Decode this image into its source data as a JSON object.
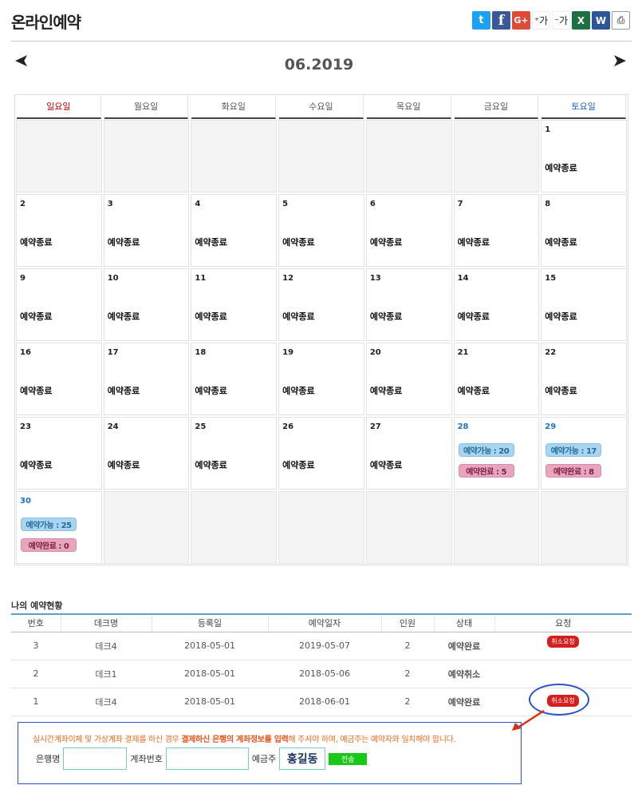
{
  "page": {
    "title": "온라인예약"
  },
  "share": {
    "twitter": "t",
    "facebook": "f",
    "google": "G+",
    "font_up": "⁺가",
    "font_down": "⁻가",
    "excel": "X",
    "word": "W",
    "print": "⎙"
  },
  "calendar": {
    "month": "06.2019",
    "prev": "➤",
    "next": "➤",
    "weekdays": [
      "일요일",
      "월요일",
      "화요일",
      "수요일",
      "목요일",
      "금요일",
      "토요일"
    ],
    "closed_label": "예약종료",
    "days": {
      "d1": "1",
      "d2": "2",
      "d3": "3",
      "d4": "4",
      "d5": "5",
      "d6": "6",
      "d7": "7",
      "d8": "8",
      "d9": "9",
      "d10": "10",
      "d11": "11",
      "d12": "12",
      "d13": "13",
      "d14": "14",
      "d15": "15",
      "d16": "16",
      "d17": "17",
      "d18": "18",
      "d19": "19",
      "d20": "20",
      "d21": "21",
      "d22": "22",
      "d23": "23",
      "d24": "24",
      "d25": "25",
      "d26": "26",
      "d27": "27",
      "d28": "28",
      "d29": "29",
      "d30": "30"
    },
    "d28_open": "예약가능 : 20",
    "d28_done": "예약완료 : 5",
    "d29_open": "예약가능 : 17",
    "d29_done": "예약완료 : 8",
    "d30_open": "예약가능 : 25",
    "d30_done": "예약완료 : 0"
  },
  "reservations": {
    "title": "나의 예약현황",
    "headers": [
      "번호",
      "데크명",
      "등록일",
      "예약일자",
      "인원",
      "상태",
      "요청"
    ],
    "rows": [
      {
        "no": "3",
        "deck": "데크4",
        "reg": "2018-05-01",
        "date": "2019-05-07",
        "people": "2",
        "status": "예약완료",
        "action": "취소요청"
      },
      {
        "no": "2",
        "deck": "데크1",
        "reg": "2018-05-01",
        "date": "2018-05-06",
        "people": "2",
        "status": "예약취소",
        "action": ""
      },
      {
        "no": "1",
        "deck": "데크4",
        "reg": "2018-05-01",
        "date": "2018-06-01",
        "people": "2",
        "status": "예약완료",
        "action": "취소요청"
      }
    ]
  },
  "refund": {
    "notice_pre": "실시간계좌이체 및 가상계좌 결제를 하신 경우 ",
    "notice_bold": "결제하신 은행의 계좌정보를 입력",
    "notice_post": "해 주셔야 하며, 예금주는 예약자와 일치해야 합니다.",
    "bank_label": "은행명",
    "account_label": "계좌번호",
    "holder_label": "예금주",
    "holder_name": "홍길동",
    "send_label": "전송",
    "bank_value": "",
    "account_value": ""
  }
}
